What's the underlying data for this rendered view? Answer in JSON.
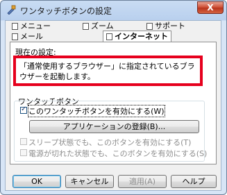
{
  "window": {
    "title": "ワンタッチボタンの設定",
    "close_label": "X"
  },
  "tabs": [
    {
      "label": "メニュー",
      "icon": "document-icon"
    },
    {
      "label": "ズーム",
      "icon": "document-icon"
    },
    {
      "label": "サポート",
      "icon": "document-icon"
    },
    {
      "label": "メール",
      "icon": "document-icon"
    },
    {
      "label": "インターネット",
      "icon": "document-icon",
      "active": true
    }
  ],
  "current_setting": {
    "label": "現在の設定:",
    "text": "「通常使用するブラウザー」に指定されているブラウザーを起動します。"
  },
  "group": {
    "label": "ワンタッチボタン",
    "enable_checkbox": {
      "label": "このワンタッチボタンを有効にする(W)",
      "checked": true
    },
    "register_button": "アプリケーションの登録(B)...",
    "sleep_checkbox": {
      "label": "スリープ状態でも、このボタンを有効にする(T)",
      "checked": false,
      "enabled": false
    },
    "poweroff_checkbox": {
      "label": "電源が切れた状態でも、このボタンを有効にする(S)",
      "checked": false,
      "enabled": false
    }
  },
  "buttons": {
    "ok": "OK",
    "cancel": "キャンセル",
    "apply": "適用(A)",
    "help": "ヘルプ"
  }
}
